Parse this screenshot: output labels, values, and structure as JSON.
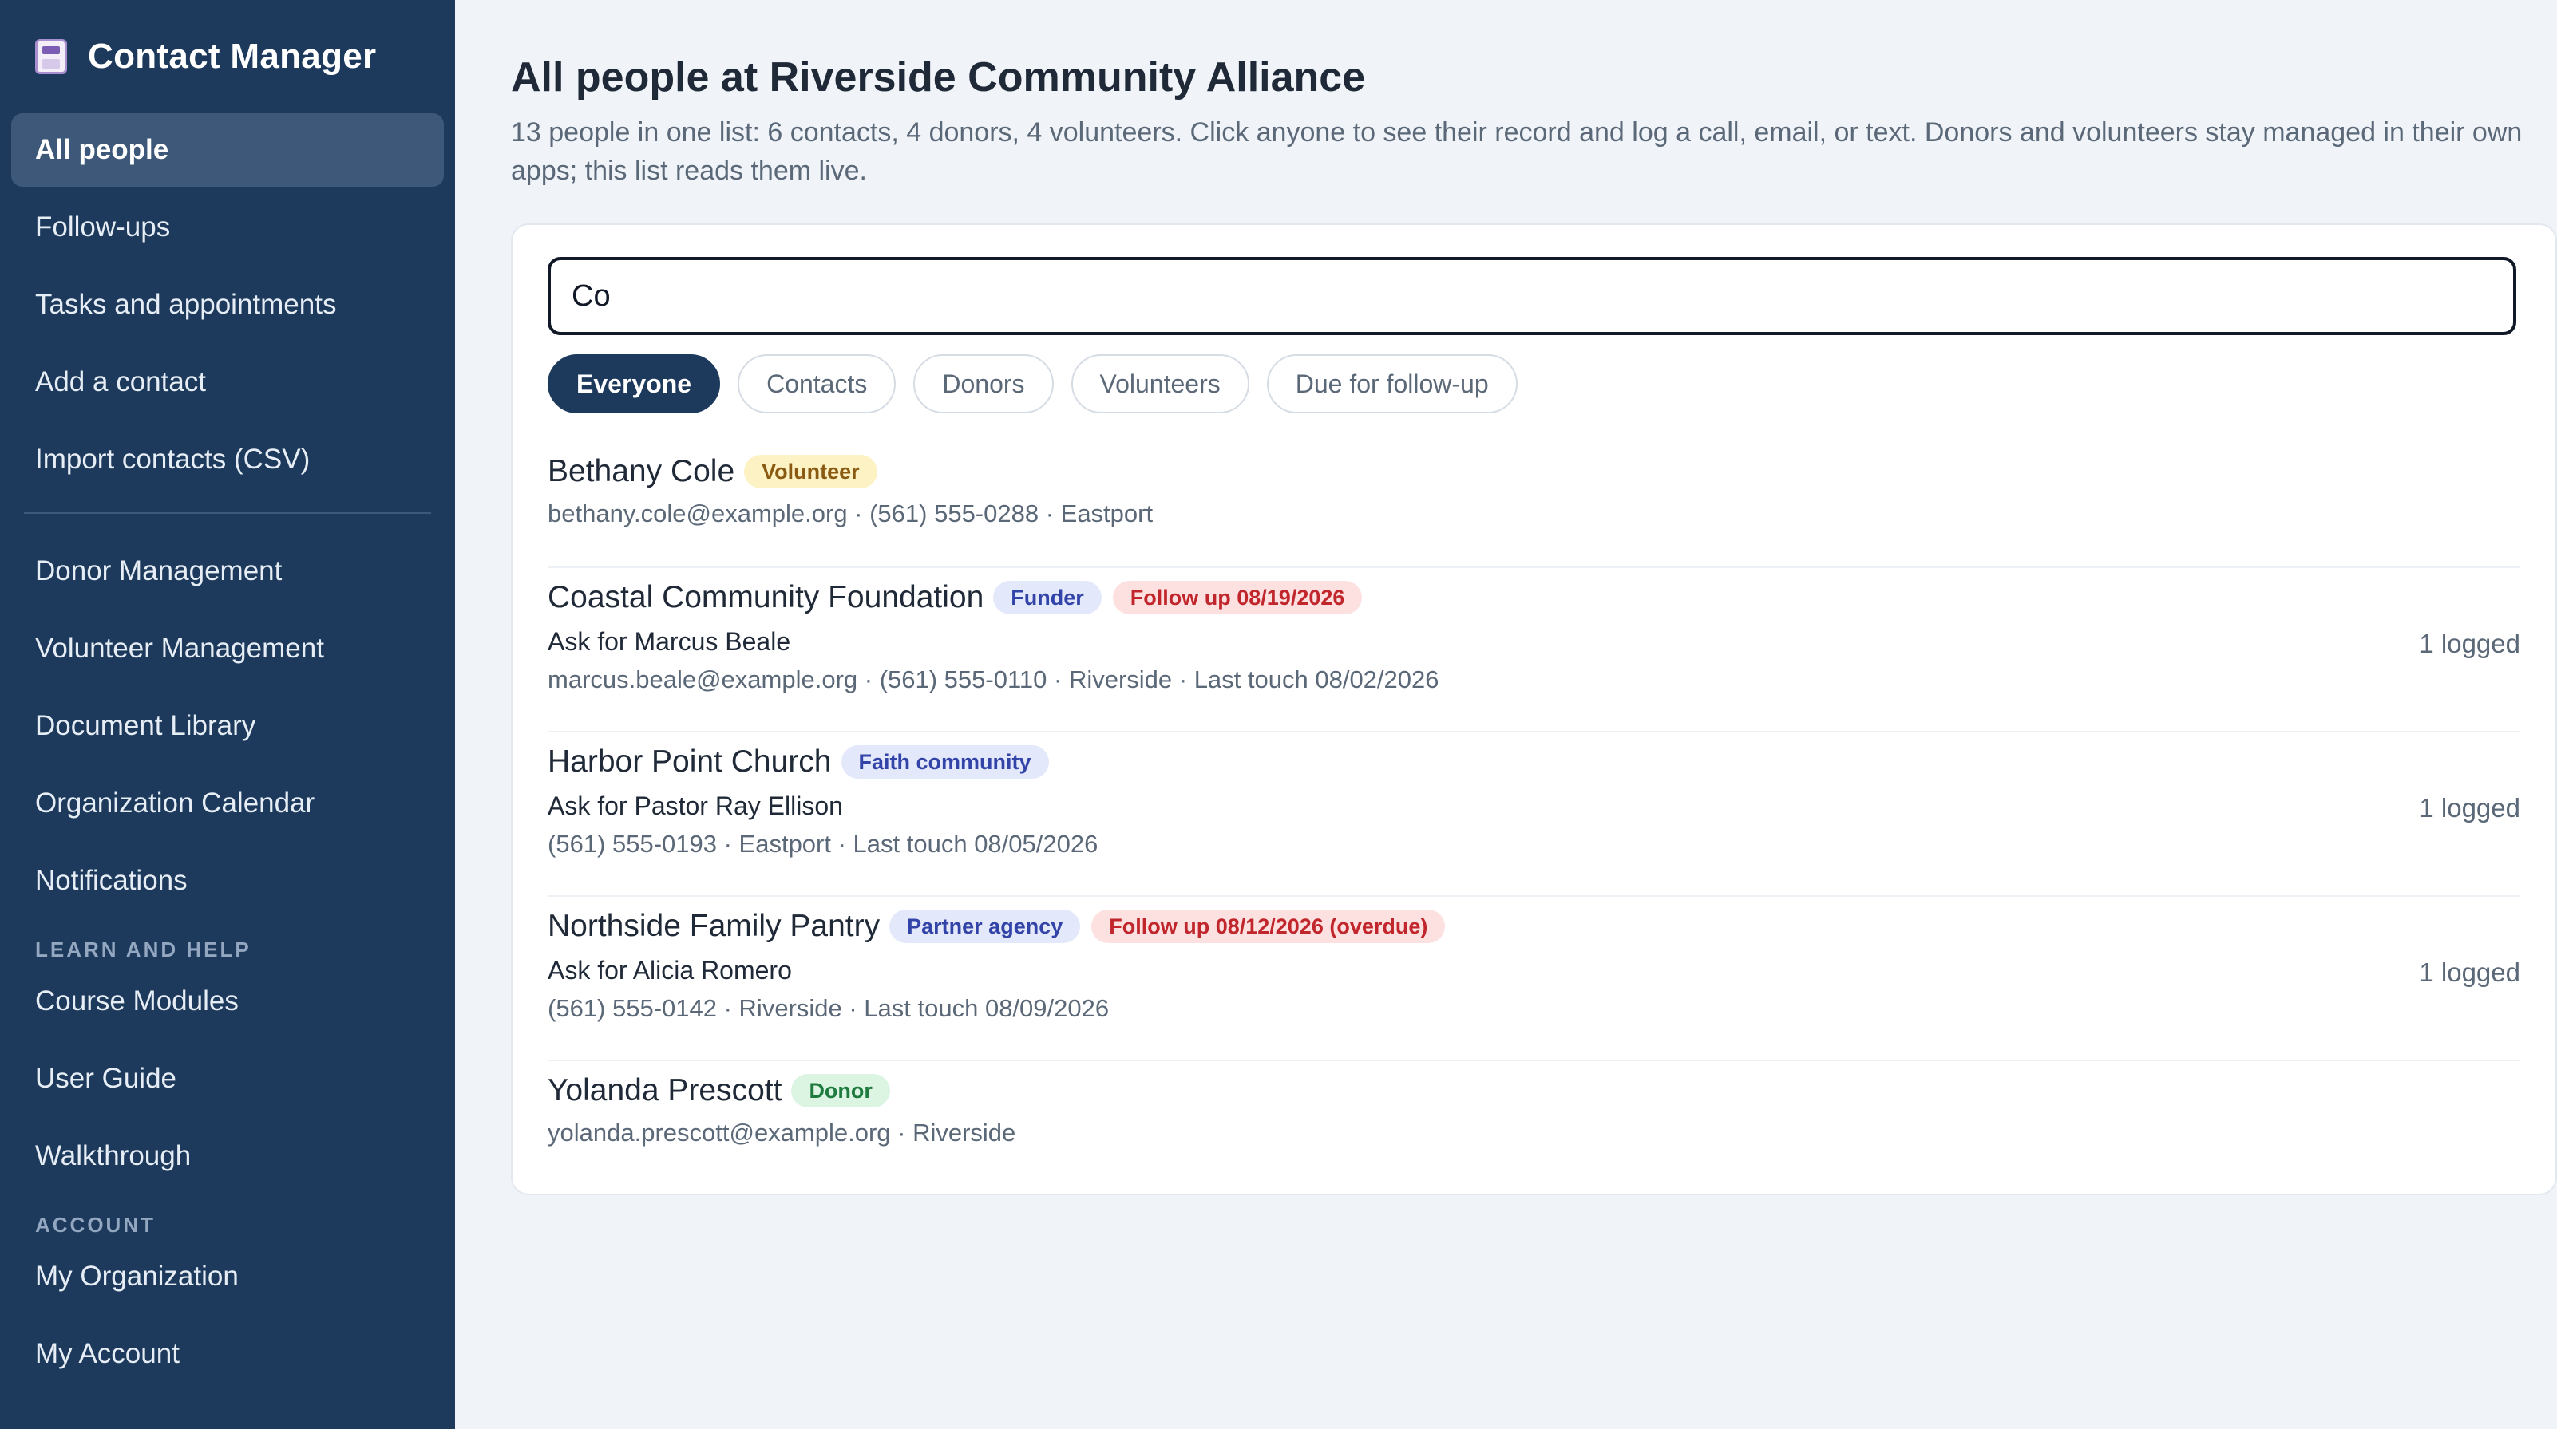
{
  "app": {
    "title": "Contact Manager",
    "brand_icon": "notebook-icon"
  },
  "sidebar": {
    "primary": [
      {
        "label": "All people",
        "active": true
      },
      {
        "label": "Follow-ups"
      },
      {
        "label": "Tasks and appointments"
      },
      {
        "label": "Add a contact"
      },
      {
        "label": "Import contacts (CSV)"
      }
    ],
    "apps": [
      {
        "label": "Donor Management"
      },
      {
        "label": "Volunteer Management"
      },
      {
        "label": "Document Library"
      },
      {
        "label": "Organization Calendar"
      },
      {
        "label": "Notifications"
      }
    ],
    "learn_title": "LEARN AND HELP",
    "learn": [
      {
        "label": "Course Modules"
      },
      {
        "label": "User Guide"
      },
      {
        "label": "Walkthrough"
      }
    ],
    "account_title": "ACCOUNT",
    "account": [
      {
        "label": "My Organization"
      },
      {
        "label": "My Account"
      }
    ]
  },
  "main": {
    "title": "All people at Riverside Community Alliance",
    "subtitle": "13 people in one list: 6 contacts, 4 donors, 4 volunteers. Click anyone to see their record and log a call, email, or text. Donors and volunteers stay managed in their own apps; this list reads them live.",
    "search": {
      "value": "Co"
    },
    "filters": [
      {
        "label": "Everyone",
        "active": true
      },
      {
        "label": "Contacts"
      },
      {
        "label": "Donors"
      },
      {
        "label": "Volunteers"
      },
      {
        "label": "Due for follow-up"
      }
    ],
    "people": [
      {
        "name": "Bethany Cole",
        "badges": [
          {
            "label": "Volunteer",
            "kind": "volunteer"
          }
        ],
        "ask": "",
        "meta": "bethany.cole@example.org · (561) 555-0288 · Eastport",
        "logged": ""
      },
      {
        "name": "Coastal Community Foundation",
        "badges": [
          {
            "label": "Funder",
            "kind": "funder"
          },
          {
            "label": "Follow up 08/19/2026",
            "kind": "followup"
          }
        ],
        "ask": "Ask for Marcus Beale",
        "meta": "marcus.beale@example.org · (561) 555-0110 · Riverside · Last touch 08/02/2026",
        "logged": "1 logged"
      },
      {
        "name": "Harbor Point Church",
        "badges": [
          {
            "label": "Faith community",
            "kind": "faith"
          }
        ],
        "ask": "Ask for Pastor Ray Ellison",
        "meta": "(561) 555-0193 · Eastport · Last touch 08/05/2026",
        "logged": "1 logged"
      },
      {
        "name": "Northside Family Pantry",
        "badges": [
          {
            "label": "Partner agency",
            "kind": "partner"
          },
          {
            "label": "Follow up 08/12/2026 (overdue)",
            "kind": "followup"
          }
        ],
        "ask": "Ask for Alicia Romero",
        "meta": "(561) 555-0142 · Riverside · Last touch 08/09/2026",
        "logged": "1 logged"
      },
      {
        "name": "Yolanda Prescott",
        "badges": [
          {
            "label": "Donor",
            "kind": "donor"
          }
        ],
        "ask": "",
        "meta": "yolanda.prescott@example.org · Riverside",
        "logged": ""
      }
    ]
  },
  "colors": {
    "sidebar_bg": "#1d3a5c",
    "active_nav": "#3d5878",
    "page_bg": "#f0f4f9",
    "followup": "#c0262b"
  }
}
